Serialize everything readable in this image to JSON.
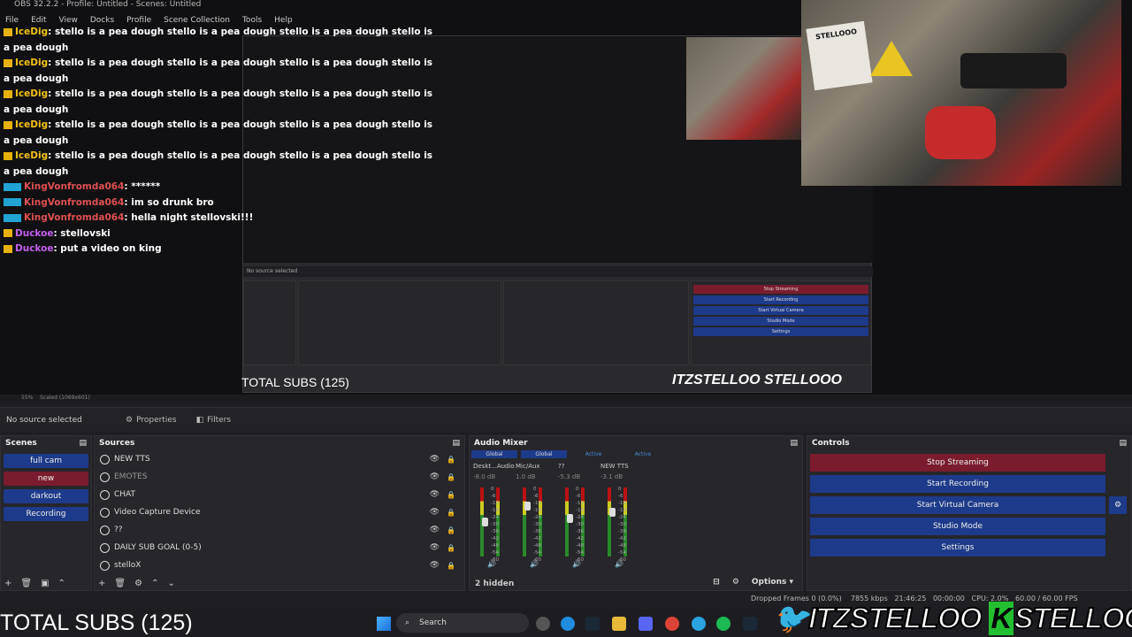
{
  "window": {
    "title": "OBS 32.2.2 - Profile: Untitled - Scenes: Untitled"
  },
  "menu": [
    "File",
    "Edit",
    "View",
    "Docks",
    "Profile",
    "Scene Collection",
    "Tools",
    "Help"
  ],
  "chat": [
    {
      "user": "IceDig",
      "text": ": stello is a pea dough stello is a pea dough stello is a pea dough stello is"
    },
    {
      "user": "",
      "text": "a pea dough"
    },
    {
      "user": "IceDig",
      "text": ": stello is a pea dough stello is a pea dough stello is a pea dough stello is"
    },
    {
      "user": "",
      "text": "a pea dough"
    },
    {
      "user": "IceDig",
      "text": ": stello is a pea dough stello is a pea dough stello is a pea dough stello is"
    },
    {
      "user": "",
      "text": "a pea dough"
    },
    {
      "user": "IceDig",
      "text": ": stello is a pea dough stello is a pea dough stello is a pea dough stello is"
    },
    {
      "user": "",
      "text": "a pea dough"
    },
    {
      "user": "IceDig",
      "text": ": stello is a pea dough stello is a pea dough stello is a pea dough stello is"
    },
    {
      "user": "",
      "text": "a pea dough"
    },
    {
      "user": "KingVonfromda064",
      "text": ": ******"
    },
    {
      "user": "KingVonfromda064",
      "text": ": im so drunk bro"
    },
    {
      "user": "KingVonfromda064",
      "text": ": hella night stellovski!!!"
    },
    {
      "user": "Duckoe",
      "text": ": stellovski"
    },
    {
      "user": "Duckoe",
      "text": ": put a video on king"
    }
  ],
  "top_partial": "a pea dough",
  "nested": {
    "total": "TOTAL SUBS (125)",
    "brand": "ITZSTELLOO",
    "brand2": "STELLOOO",
    "no_source": "No source selected",
    "stop": "Stop Streaming",
    "rec": "Start Recording",
    "vcam": "Start Virtual Camera",
    "studio": "Studio Mode",
    "settings": "Settings"
  },
  "webcam_sign": "STELLOOO",
  "zoom": {
    "pct": "55%",
    "scaled": "Scaled (1069x601)"
  },
  "source_bar": {
    "no_source": "No source selected",
    "properties": "Properties",
    "filters": "Filters"
  },
  "scenes": {
    "title": "Scenes",
    "items": [
      "full cam",
      "new",
      "darkout",
      "Recording"
    ]
  },
  "sources": {
    "title": "Sources",
    "items": [
      "NEW TTS",
      "EMOTES",
      "CHAT",
      "Video Capture Device",
      "??",
      "DAILY SUB GOAL (0-5)",
      "stelloX"
    ]
  },
  "mixer": {
    "title": "Audio Mixer",
    "heads": [
      "Global",
      "Global",
      "Active",
      "Active"
    ],
    "channels": [
      {
        "name": "Deskt...Audio",
        "db": "-8.0 dB",
        "level": 0.55
      },
      {
        "name": "Mic/Aux",
        "db": "1.0 dB",
        "level": 0.8
      },
      {
        "name": "??",
        "db": "-5.3 dB",
        "level": 0.6
      },
      {
        "name": "NEW TTS",
        "db": "-3.1 dB",
        "level": 0.7
      }
    ],
    "scale": [
      "0",
      "-6",
      "-12",
      "-18",
      "-24",
      "-30",
      "-36",
      "-42",
      "-48",
      "-54",
      "-60"
    ],
    "hidden": "2 hidden",
    "options": "Options"
  },
  "controls": {
    "title": "Controls",
    "stop": "Stop Streaming",
    "record": "Start Recording",
    "vcam": "Start Virtual Camera",
    "studio": "Studio Mode",
    "settings": "Settings"
  },
  "status": {
    "dropped": "Dropped Frames 0 (0.0%)",
    "kbps": "7855 kbps",
    "time1": "21:46:25",
    "time2": "00:00:00",
    "cpu": "CPU: 2.0%",
    "fps": "60.00 / 60.00 FPS"
  },
  "taskbar": {
    "search": "Search"
  },
  "overlay": {
    "total": "TOTAL SUBS (125)",
    "brand": "ITZSTELLOO",
    "brand_k": "K",
    "brand2": "STELLOOO"
  },
  "colors": {
    "scene_blue": "#1e3a8a",
    "active_red": "#7a1c2e"
  }
}
